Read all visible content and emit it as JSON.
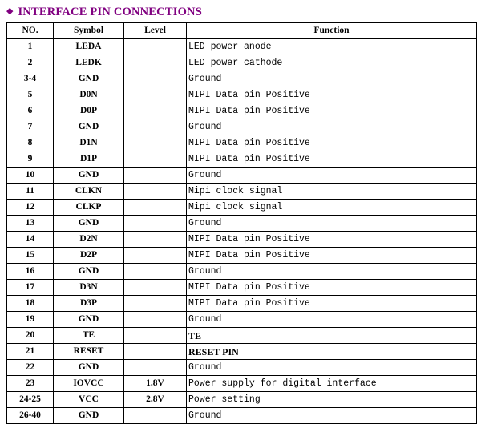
{
  "heading": {
    "icon": "diamond-bullet-icon",
    "text": "INTERFACE PIN CONNECTIONS",
    "color": "#800080"
  },
  "table": {
    "columns": [
      "NO.",
      "Symbol",
      "Level",
      "Function"
    ],
    "rows": [
      {
        "no": "1",
        "symbol": "LEDA",
        "level": "",
        "function": "LED power anode",
        "bold_function": false
      },
      {
        "no": "2",
        "symbol": "LEDK",
        "level": "",
        "function": "LED power cathode",
        "bold_function": false
      },
      {
        "no": "3-4",
        "symbol": "GND",
        "level": "",
        "function": "Ground",
        "bold_function": false
      },
      {
        "no": "5",
        "symbol": "D0N",
        "level": "",
        "function": "MIPI Data pin Positive",
        "bold_function": false
      },
      {
        "no": "6",
        "symbol": "D0P",
        "level": "",
        "function": "MIPI Data pin Positive",
        "bold_function": false
      },
      {
        "no": "7",
        "symbol": "GND",
        "level": "",
        "function": "Ground",
        "bold_function": false
      },
      {
        "no": "8",
        "symbol": "D1N",
        "level": "",
        "function": "MIPI Data pin Positive",
        "bold_function": false
      },
      {
        "no": "9",
        "symbol": "D1P",
        "level": "",
        "function": "MIPI Data pin Positive",
        "bold_function": false
      },
      {
        "no": "10",
        "symbol": "GND",
        "level": "",
        "function": "Ground",
        "bold_function": false
      },
      {
        "no": "11",
        "symbol": "CLKN",
        "level": "",
        "function": "Mipi clock signal",
        "bold_function": false
      },
      {
        "no": "12",
        "symbol": "CLKP",
        "level": "",
        "function": "Mipi clock signal",
        "bold_function": false
      },
      {
        "no": "13",
        "symbol": "GND",
        "level": "",
        "function": "Ground",
        "bold_function": false
      },
      {
        "no": "14",
        "symbol": "D2N",
        "level": "",
        "function": "MIPI Data pin Positive",
        "bold_function": false
      },
      {
        "no": "15",
        "symbol": "D2P",
        "level": "",
        "function": "MIPI Data pin Positive",
        "bold_function": false
      },
      {
        "no": "16",
        "symbol": "GND",
        "level": "",
        "function": "Ground",
        "bold_function": false
      },
      {
        "no": "17",
        "symbol": "D3N",
        "level": "",
        "function": "MIPI Data pin Positive",
        "bold_function": false
      },
      {
        "no": "18",
        "symbol": "D3P",
        "level": "",
        "function": "MIPI Data pin Positive",
        "bold_function": false
      },
      {
        "no": "19",
        "symbol": "GND",
        "level": "",
        "function": "Ground",
        "bold_function": false
      },
      {
        "no": "20",
        "symbol": "TE",
        "level": "",
        "function": "TE",
        "bold_function": true
      },
      {
        "no": "21",
        "symbol": "RESET",
        "level": "",
        "function": "RESET PIN",
        "bold_function": true
      },
      {
        "no": "22",
        "symbol": "GND",
        "level": "",
        "function": "Ground",
        "bold_function": false
      },
      {
        "no": "23",
        "symbol": "IOVCC",
        "level": "1.8V",
        "function": "Power supply for digital interface",
        "bold_function": false
      },
      {
        "no": "24-25",
        "symbol": "VCC",
        "level": "2.8V",
        "function": "Power setting",
        "bold_function": false
      },
      {
        "no": "26-40",
        "symbol": "GND",
        "level": "",
        "function": "Ground",
        "bold_function": false
      }
    ]
  }
}
